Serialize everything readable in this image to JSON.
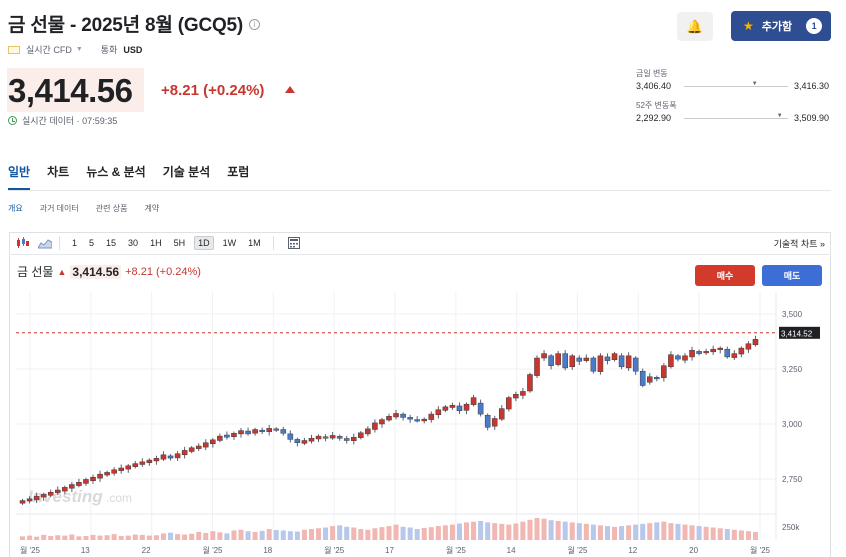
{
  "header": {
    "title": "금 선물 - 2025년 8월 (GCQ5)",
    "meta_type": "실시간 CFD",
    "meta_currency_label": "통화",
    "meta_currency": "USD"
  },
  "quote": {
    "price": "3,414.56",
    "change": "+8.21 (+0.24%)",
    "status": "실시간 데이터 · 07:59:35"
  },
  "actions": {
    "add_label": "추가함",
    "add_count": "1"
  },
  "ranges": {
    "day_label": "금일 변동",
    "day_low": "3,406.40",
    "day_high": "3,416.30",
    "day_position": 0.68,
    "week52_label": "52주 변동폭",
    "week52_low": "2,292.90",
    "week52_high": "3,509.90",
    "week52_position": 0.92
  },
  "tabs": [
    "일반",
    "차트",
    "뉴스 & 분석",
    "기술 분석",
    "포럼"
  ],
  "subtabs": [
    "개요",
    "과거 데이터",
    "관련 상품",
    "계약"
  ],
  "chart_toolbar": {
    "timeframes": [
      "1",
      "5",
      "15",
      "30",
      "1H",
      "5H",
      "1D",
      "1W",
      "1M"
    ],
    "active_timeframe": "1D",
    "tech_chart_link": "기술적 차트 »"
  },
  "chart_header": {
    "name": "금 선물",
    "price": "3,414.56",
    "change": "+8.21 (+0.24%)",
    "buy_label": "매수",
    "sell_label": "매도"
  },
  "chart_data": {
    "type": "candlestick",
    "y_ticks": [
      "3,500",
      "3,250",
      "3,000",
      "2,750"
    ],
    "y_tick_values": [
      3500,
      3250,
      3000,
      2750
    ],
    "volume_tick": "250k",
    "last_price_label": "3,414.52",
    "last_price": 3414.52,
    "ylim": [
      2600,
      3600
    ],
    "x_tick_labels": [
      "월 '25",
      "13",
      "22",
      "월 '25",
      "18",
      "월 '25",
      "17",
      "월 '25",
      "14",
      "월 '25",
      "12",
      "20",
      "월 '25"
    ],
    "watermark": "Investing",
    "watermark_suffix": ".com",
    "colors": {
      "up": "#c7372f",
      "down": "#4a7ac8"
    },
    "candles": [
      {
        "o": 2640,
        "c": 2652
      },
      {
        "o": 2650,
        "c": 2660
      },
      {
        "o": 2655,
        "c": 2672
      },
      {
        "o": 2668,
        "c": 2680
      },
      {
        "o": 2676,
        "c": 2690
      },
      {
        "o": 2688,
        "c": 2700
      },
      {
        "o": 2695,
        "c": 2712
      },
      {
        "o": 2708,
        "c": 2725
      },
      {
        "o": 2720,
        "c": 2735
      },
      {
        "o": 2730,
        "c": 2748
      },
      {
        "o": 2742,
        "c": 2758
      },
      {
        "o": 2754,
        "c": 2772
      },
      {
        "o": 2768,
        "c": 2780
      },
      {
        "o": 2776,
        "c": 2792
      },
      {
        "o": 2788,
        "c": 2800
      },
      {
        "o": 2795,
        "c": 2810
      },
      {
        "o": 2806,
        "c": 2820
      },
      {
        "o": 2816,
        "c": 2828
      },
      {
        "o": 2824,
        "c": 2836
      },
      {
        "o": 2832,
        "c": 2844
      },
      {
        "o": 2840,
        "c": 2860
      },
      {
        "o": 2855,
        "c": 2845
      },
      {
        "o": 2846,
        "c": 2865
      },
      {
        "o": 2860,
        "c": 2880
      },
      {
        "o": 2875,
        "c": 2892
      },
      {
        "o": 2888,
        "c": 2900
      },
      {
        "o": 2895,
        "c": 2915
      },
      {
        "o": 2910,
        "c": 2928
      },
      {
        "o": 2925,
        "c": 2945
      },
      {
        "o": 2950,
        "c": 2940
      },
      {
        "o": 2942,
        "c": 2958
      },
      {
        "o": 2955,
        "c": 2970
      },
      {
        "o": 2968,
        "c": 2955
      },
      {
        "o": 2958,
        "c": 2975
      },
      {
        "o": 2972,
        "c": 2968
      },
      {
        "o": 2965,
        "c": 2980
      },
      {
        "o": 2978,
        "c": 2972
      },
      {
        "o": 2975,
        "c": 2958
      },
      {
        "o": 2955,
        "c": 2930
      },
      {
        "o": 2930,
        "c": 2915
      },
      {
        "o": 2912,
        "c": 2925
      },
      {
        "o": 2922,
        "c": 2935
      },
      {
        "o": 2932,
        "c": 2945
      },
      {
        "o": 2942,
        "c": 2938
      },
      {
        "o": 2936,
        "c": 2948
      },
      {
        "o": 2944,
        "c": 2935
      },
      {
        "o": 2934,
        "c": 2925
      },
      {
        "o": 2924,
        "c": 2940
      },
      {
        "o": 2938,
        "c": 2960
      },
      {
        "o": 2955,
        "c": 2978
      },
      {
        "o": 2975,
        "c": 3005
      },
      {
        "o": 3000,
        "c": 3020
      },
      {
        "o": 3018,
        "c": 3035
      },
      {
        "o": 3032,
        "c": 3048
      },
      {
        "o": 3045,
        "c": 3030
      },
      {
        "o": 3030,
        "c": 3022
      },
      {
        "o": 3020,
        "c": 3015
      },
      {
        "o": 3014,
        "c": 3022
      },
      {
        "o": 3020,
        "c": 3045
      },
      {
        "o": 3042,
        "c": 3065
      },
      {
        "o": 3062,
        "c": 3078
      },
      {
        "o": 3075,
        "c": 3085
      },
      {
        "o": 3082,
        "c": 3060
      },
      {
        "o": 3062,
        "c": 3090
      },
      {
        "o": 3088,
        "c": 3120
      },
      {
        "o": 3095,
        "c": 3045
      },
      {
        "o": 3040,
        "c": 2985
      },
      {
        "o": 2990,
        "c": 3025
      },
      {
        "o": 3022,
        "c": 3070
      },
      {
        "o": 3068,
        "c": 3120
      },
      {
        "o": 3118,
        "c": 3135
      },
      {
        "o": 3130,
        "c": 3148
      },
      {
        "o": 3150,
        "c": 3225
      },
      {
        "o": 3220,
        "c": 3300
      },
      {
        "o": 3300,
        "c": 3320
      },
      {
        "o": 3310,
        "c": 3265
      },
      {
        "o": 3270,
        "c": 3320
      },
      {
        "o": 3320,
        "c": 3255
      },
      {
        "o": 3260,
        "c": 3310
      },
      {
        "o": 3300,
        "c": 3285
      },
      {
        "o": 3288,
        "c": 3300
      },
      {
        "o": 3300,
        "c": 3240
      },
      {
        "o": 3238,
        "c": 3310
      },
      {
        "o": 3305,
        "c": 3288
      },
      {
        "o": 3292,
        "c": 3320
      },
      {
        "o": 3310,
        "c": 3260
      },
      {
        "o": 3255,
        "c": 3310
      },
      {
        "o": 3300,
        "c": 3240
      },
      {
        "o": 3240,
        "c": 3175
      },
      {
        "o": 3190,
        "c": 3215
      },
      {
        "o": 3212,
        "c": 3208
      },
      {
        "o": 3210,
        "c": 3265
      },
      {
        "o": 3260,
        "c": 3315
      },
      {
        "o": 3310,
        "c": 3295
      },
      {
        "o": 3290,
        "c": 3310
      },
      {
        "o": 3305,
        "c": 3335
      },
      {
        "o": 3330,
        "c": 3320
      },
      {
        "o": 3325,
        "c": 3330
      },
      {
        "o": 3328,
        "c": 3340
      },
      {
        "o": 3338,
        "c": 3345
      },
      {
        "o": 3340,
        "c": 3305
      },
      {
        "o": 3302,
        "c": 3320
      },
      {
        "o": 3318,
        "c": 3345
      },
      {
        "o": 3340,
        "c": 3365
      },
      {
        "o": 3360,
        "c": 3385
      }
    ],
    "volumes": [
      10,
      12,
      9,
      14,
      11,
      13,
      12,
      15,
      10,
      11,
      14,
      12,
      13,
      16,
      11,
      12,
      15,
      14,
      12,
      13,
      18,
      20,
      16,
      15,
      17,
      22,
      19,
      24,
      21,
      18,
      26,
      28,
      24,
      22,
      25,
      30,
      27,
      26,
      24,
      23,
      28,
      30,
      32,
      34,
      38,
      40,
      36,
      34,
      30,
      28,
      32,
      35,
      38,
      42,
      36,
      34,
      30,
      33,
      35,
      38,
      40,
      42,
      45,
      48,
      50,
      52,
      48,
      46,
      44,
      42,
      45,
      50,
      55,
      60,
      58,
      54,
      52,
      50,
      48,
      46,
      44,
      42,
      40,
      38,
      36,
      38,
      40,
      42,
      44,
      46,
      48,
      50,
      46,
      44,
      42,
      40,
      38,
      36,
      34,
      32,
      30,
      28,
      26,
      24,
      22
    ]
  }
}
